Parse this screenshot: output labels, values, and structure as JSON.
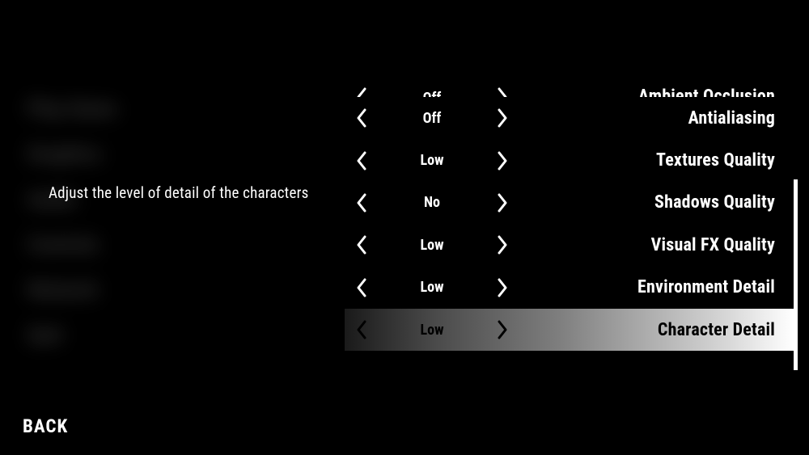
{
  "description": "Adjust the level of detail of the characters",
  "back_label": "BACK",
  "ghost_menu": [
    "Play Game",
    "Graphics",
    "Audio",
    "Controls",
    "Network",
    "Quit"
  ],
  "settings": [
    {
      "label": "Ambient Occlusion",
      "value": "Off",
      "selected": false,
      "cutoff": true
    },
    {
      "label": "Antialiasing",
      "value": "Off",
      "selected": false,
      "cutoff": false
    },
    {
      "label": "Textures Quality",
      "value": "Low",
      "selected": false,
      "cutoff": false
    },
    {
      "label": "Shadows Quality",
      "value": "No",
      "selected": false,
      "cutoff": false
    },
    {
      "label": "Visual FX Quality",
      "value": "Low",
      "selected": false,
      "cutoff": false
    },
    {
      "label": "Environment Detail",
      "value": "Low",
      "selected": false,
      "cutoff": false
    },
    {
      "label": "Character Detail",
      "value": "Low",
      "selected": true,
      "cutoff": false
    }
  ]
}
